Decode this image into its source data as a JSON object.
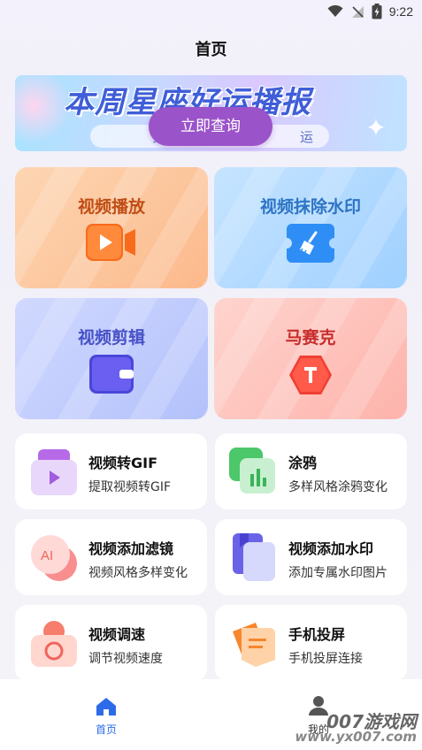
{
  "status_bar": {
    "time": "9:22",
    "icons": [
      "wifi-icon",
      "signal-off-icon",
      "battery-charging-icon"
    ]
  },
  "header": {
    "title": "首页"
  },
  "banner": {
    "title": "本周星座好运播报",
    "subtitle_left": "分",
    "subtitle_right": "运",
    "cta_label": "立即查询"
  },
  "big_cards": [
    {
      "label": "视频播放",
      "icon": "video-play-icon"
    },
    {
      "label": "视频抹除水印",
      "icon": "broom-ticket-icon"
    },
    {
      "label": "视频剪辑",
      "icon": "wallet-icon"
    },
    {
      "label": "马赛克",
      "icon": "hexagon-t-icon"
    }
  ],
  "small_cards": [
    {
      "title": "视频转GIF",
      "subtitle": "提取视频转GIF",
      "icon": "gif-play-icon"
    },
    {
      "title": "涂鸦",
      "subtitle": "多样风格涂鸦变化",
      "icon": "doodle-chart-icon"
    },
    {
      "title": "视频添加滤镜",
      "subtitle": "视频风格多样变化",
      "icon": "ai-filter-icon"
    },
    {
      "title": "视频添加水印",
      "subtitle": "添加专属水印图片",
      "icon": "bookmark-doc-icon"
    },
    {
      "title": "视频调速",
      "subtitle": "调节视频速度",
      "icon": "speed-camera-icon"
    },
    {
      "title": "手机投屏",
      "subtitle": "手机投屏连接",
      "icon": "cast-screen-icon"
    }
  ],
  "bottom_nav": {
    "home_label": "首页",
    "mine_label": "我的"
  },
  "watermark": {
    "line1": "007游戏网",
    "line2": "www.yx007.com"
  },
  "colors": {
    "accent_blue": "#2d6bea",
    "cta_purple": "#9a53c9"
  }
}
